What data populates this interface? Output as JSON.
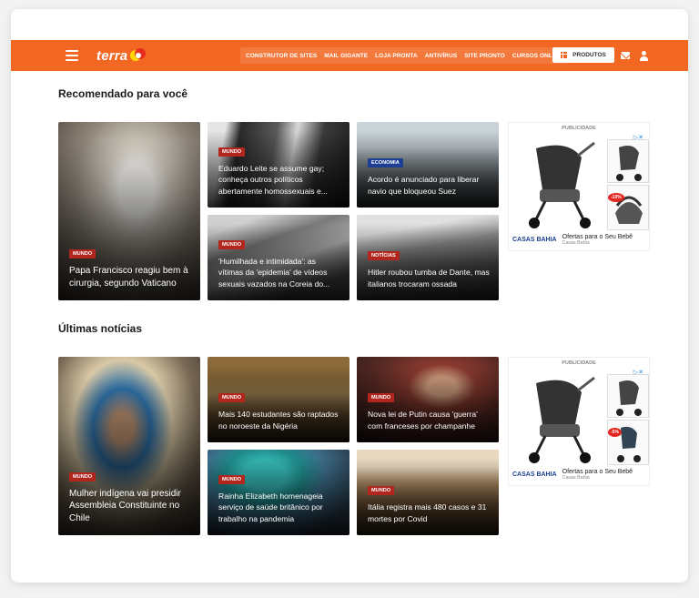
{
  "header": {
    "logo_text": "terra",
    "nav_links": [
      "CONSTRUTOR DE SITES",
      "MAIL GIGANTE",
      "LOJA PRONTA",
      "ANTIVÍRUS",
      "SITE PRONTO",
      "CURSOS ONLINE"
    ],
    "produtos_label": "PRODUTOS",
    "icons": [
      "menu-icon",
      "grid-icon",
      "mail-icon",
      "user-icon"
    ],
    "accent_color": "#f26722"
  },
  "sections": [
    {
      "title": "Recomendado para você",
      "cards": [
        {
          "tag": "MUNDO",
          "tag_color": "#b3261e",
          "title": "Papa Francisco reagiu bem à cirurgia, segundo Vaticano"
        },
        {
          "tag": "MUNDO",
          "tag_color": "#b3261e",
          "title": "Eduardo Leite se assume gay; conheça outros políticos abertamente homossexuais e..."
        },
        {
          "tag": "ECONOMIA",
          "tag_color": "#1c3f94",
          "title": "Acordo é anunciado para liberar navio que bloqueou Suez"
        },
        {
          "tag": "MUNDO",
          "tag_color": "#b3261e",
          "title": "'Humilhada e intimidada': as vítimas da 'epidemia' de vídeos sexuais vazados na Coreia do..."
        },
        {
          "tag": "NOTÍCIAS",
          "tag_color": "#b3261e",
          "title": "Hitler roubou tumba de Dante, mas italianos trocaram ossada"
        }
      ],
      "ad": {
        "label": "PUBLICIDADE",
        "brand": "CASAS BAHIA",
        "title": "Ofertas para o Seu Bebê",
        "subtitle": "Casas Bahia",
        "discount": "-10%"
      }
    },
    {
      "title": "Últimas notícias",
      "cards": [
        {
          "tag": "MUNDO",
          "tag_color": "#b3261e",
          "title": "Mulher indígena vai presidir Assembleia Constituinte no Chile"
        },
        {
          "tag": "MUNDO",
          "tag_color": "#b3261e",
          "title": "Mais 140 estudantes são raptados no noroeste da Nigéria"
        },
        {
          "tag": "MUNDO",
          "tag_color": "#b3261e",
          "title": "Nova lei de Putin causa 'guerra' com franceses por champanhe"
        },
        {
          "tag": "MUNDO",
          "tag_color": "#b3261e",
          "title": "Rainha Elizabeth homenageia serviço de saúde britânico por trabalho na pandemia"
        },
        {
          "tag": "MUNDO",
          "tag_color": "#b3261e",
          "title": "Itália registra mais 480 casos e 31 mortes por Covid"
        }
      ],
      "ad": {
        "label": "PUBLICIDADE",
        "brand": "CASAS BAHIA",
        "title": "Ofertas para o Seu Bebê",
        "subtitle": "Casas Bahia",
        "discount": "-5%"
      }
    }
  ]
}
